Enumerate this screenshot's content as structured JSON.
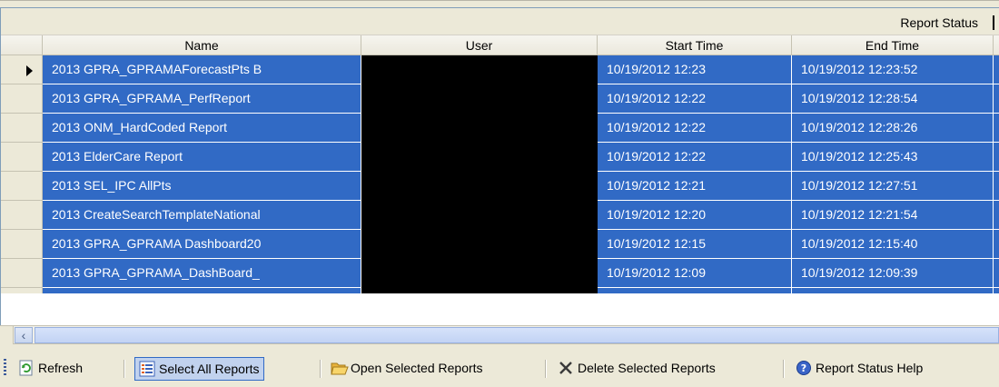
{
  "caption": {
    "title": "Report Status"
  },
  "columns": [
    {
      "key": "name",
      "label": "Name"
    },
    {
      "key": "user",
      "label": "User"
    },
    {
      "key": "start",
      "label": "Start Time"
    },
    {
      "key": "end",
      "label": "End Time"
    }
  ],
  "rows": [
    {
      "name": "2013 GPRA_GPRAMAForecastPts B",
      "user": "",
      "start": "10/19/2012 12:23",
      "end": "10/19/2012 12:23:52",
      "current": true
    },
    {
      "name": "2013 GPRA_GPRAMA_PerfReport",
      "user": "",
      "start": "10/19/2012 12:22",
      "end": "10/19/2012 12:28:54"
    },
    {
      "name": "2013 ONM_HardCoded Report",
      "user": "",
      "start": "10/19/2012 12:22",
      "end": "10/19/2012 12:28:26"
    },
    {
      "name": "2013 ElderCare Report",
      "user": "",
      "start": "10/19/2012 12:22",
      "end": "10/19/2012 12:25:43"
    },
    {
      "name": "2013 SEL_IPC AllPts",
      "user": "",
      "start": "10/19/2012 12:21",
      "end": "10/19/2012 12:27:51"
    },
    {
      "name": "2013 CreateSearchTemplateNational",
      "user": "",
      "start": "10/19/2012 12:20",
      "end": "10/19/2012 12:21:54"
    },
    {
      "name": "2013 GPRA_GPRAMA Dashboard20",
      "user": "",
      "start": "10/19/2012 12:15",
      "end": "10/19/2012 12:15:40"
    },
    {
      "name": "2013 GPRA_GPRAMA_DashBoard_",
      "user": "",
      "start": "10/19/2012 12:09",
      "end": "10/19/2012 12:09:39"
    }
  ],
  "toolbar": {
    "refresh": "Refresh",
    "select_all": "Select All Reports",
    "open": "Open Selected Reports",
    "delete": "Delete Selected Reports",
    "help": "Report Status Help"
  },
  "icons": {
    "refresh": "refresh-icon",
    "select_all": "list-icon",
    "open": "folder-open-icon",
    "delete": "delete-x-icon",
    "help": "help-icon"
  },
  "colors": {
    "selection": "#316ac5",
    "redacted": "#000000",
    "chrome": "#ece9d8"
  }
}
